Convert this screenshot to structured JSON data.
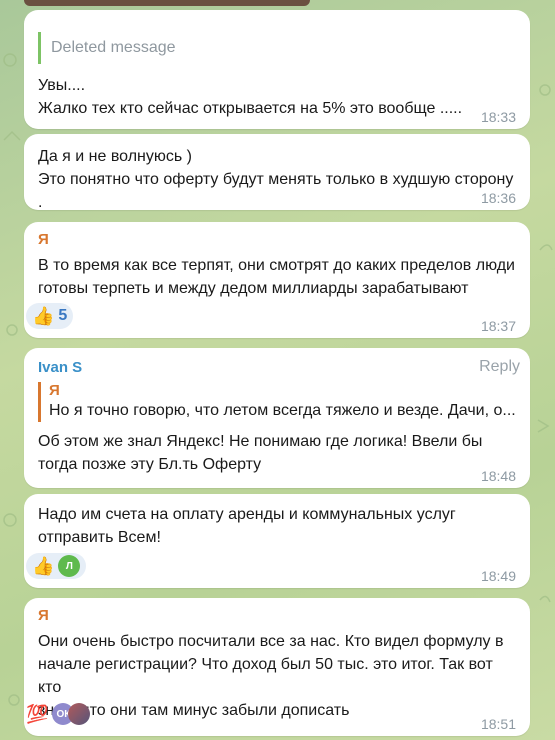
{
  "colors": {
    "accent_green": "#7dc365",
    "sender_orange": "#d8772f",
    "sender_blue": "#3a90c8"
  },
  "messages": [
    {
      "deleted_label": "Deleted message",
      "lines": [
        "Увы....",
        "Жалко тех кто сейчас открывается на 5% это вообще ....."
      ],
      "time": "18:33"
    },
    {
      "lines": [
        "Да я и не волнуюсь )",
        "Это понятно что оферту будут менять только в худшую сторону ."
      ],
      "time": "18:36"
    },
    {
      "sender": "Я",
      "lines": [
        "В то время как все терпят, они смотрят до каких пределов люди",
        "готовы терпеть и между дедом миллиарды зарабатывают"
      ],
      "reactions": [
        {
          "emoji": "👍",
          "count": "5"
        }
      ],
      "time": "18:37"
    },
    {
      "sender": "Ivan S",
      "reply_label": "Reply",
      "quote": {
        "sender": "Я",
        "text": "Но я точно говорю, что летом всегда тяжело и везде. Дачи, о..."
      },
      "lines": [
        "Об этом же знал Яндекс! Не понимаю где логика! Ввели бы",
        "тогда позже эту Бл.ть Оферту"
      ],
      "time": "18:48"
    },
    {
      "lines": [
        "Надо им счета на оплату аренды и коммунальных услуг",
        "отправить Всем!"
      ],
      "reactions": [
        {
          "emoji": "👍",
          "avatar": "Л"
        }
      ],
      "time": "18:49"
    },
    {
      "sender": "Я",
      "lines": [
        "Они очень быстро посчитали все за нас. Кто видел формулу в",
        "начале регистрации? Что доход был 50 тыс. это итог. Так вот кто",
        "знал, что они там минус забыли дописать"
      ],
      "reactions": [
        {
          "emoji": "💯",
          "avatar": "ОК"
        }
      ],
      "time": "18:51"
    }
  ]
}
